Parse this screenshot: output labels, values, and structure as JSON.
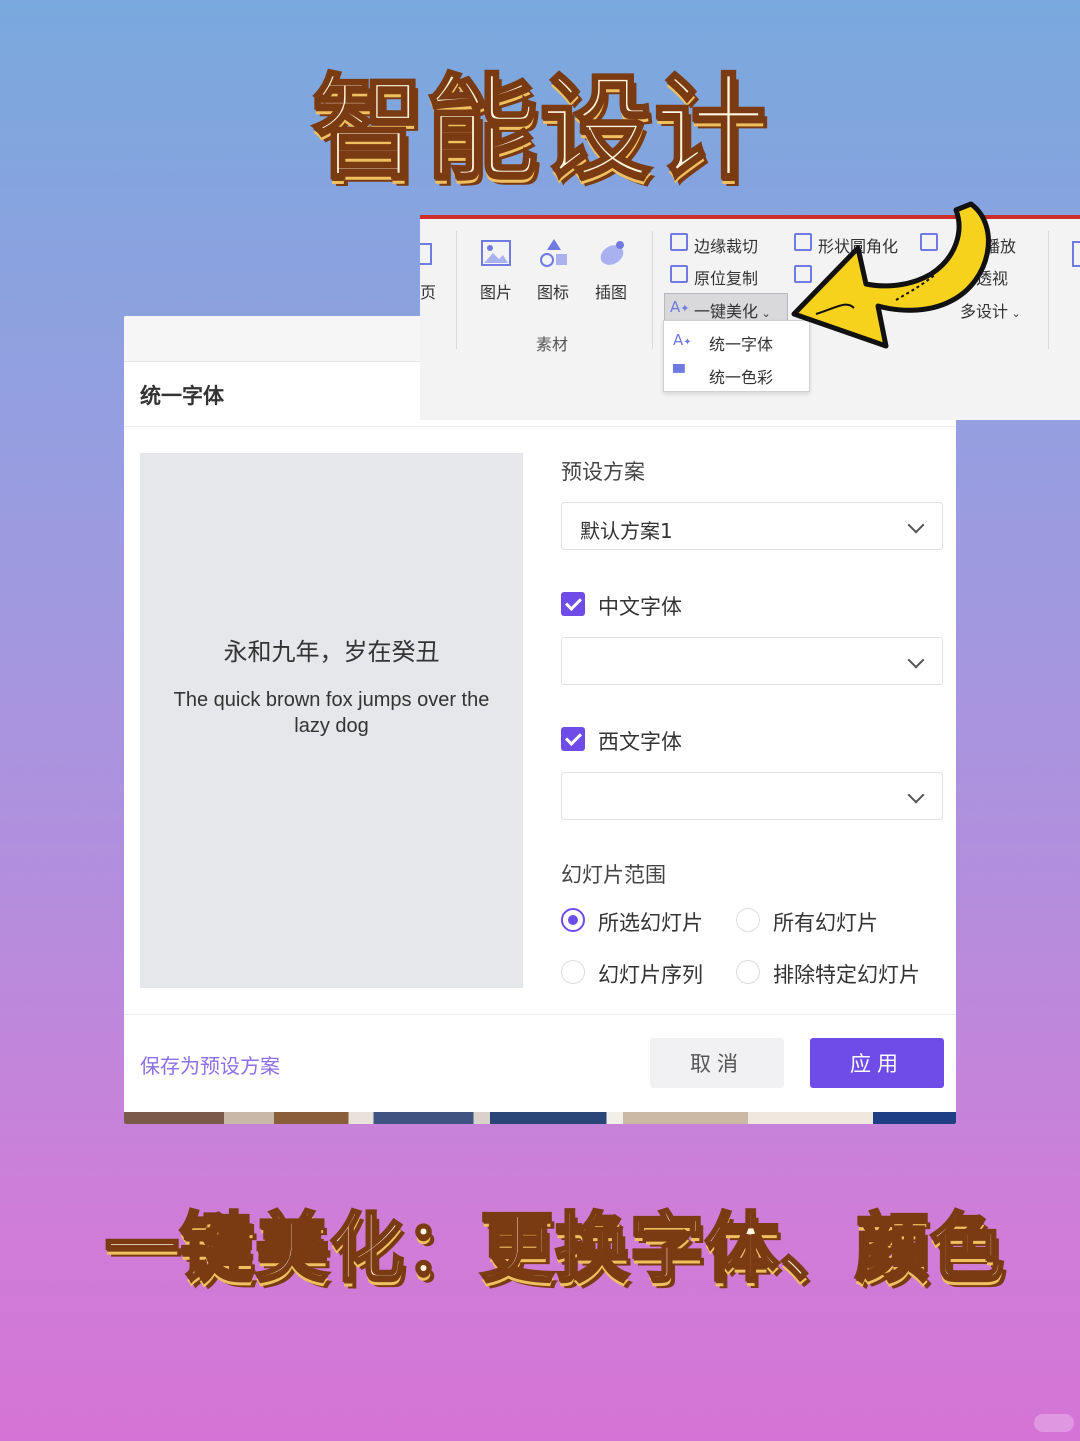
{
  "headline_top": "智能设计",
  "headline_bottom": "一键美化：更换字体、颜色",
  "ribbon": {
    "page_label": "页",
    "tools": [
      {
        "label": "图片",
        "icon": "image-icon"
      },
      {
        "label": "图标",
        "icon": "shapes-icon"
      },
      {
        "label": "插图",
        "icon": "illustration-icon"
      }
    ],
    "group_label": "素材",
    "col1": [
      "边缘裁切",
      "原位复制",
      "一键美化"
    ],
    "col2": [
      "形状圆角化"
    ],
    "col3": [
      "播放",
      "透视",
      "多设计"
    ],
    "dropdown": [
      "统一字体",
      "统一色彩"
    ]
  },
  "dialog": {
    "title": "统一字体",
    "preview_cn": "永和九年，岁在癸丑",
    "preview_en": "The quick brown fox jumps over the lazy dog",
    "preset_label": "预设方案",
    "preset_value": "默认方案1",
    "cn_font_label": "中文字体",
    "cn_font_value": "",
    "en_font_label": "西文字体",
    "en_font_value": "",
    "range_label": "幻灯片范围",
    "range_options": [
      "所选幻灯片",
      "所有幻灯片",
      "幻灯片序列",
      "排除特定幻灯片"
    ],
    "range_selected": "所选幻灯片",
    "save_preset": "保存为预设方案",
    "cancel": "取消",
    "apply": "应用"
  },
  "colors": {
    "accent": "#6f4be8",
    "ribbon_top_border": "#c9302c",
    "headline_fill": "#fff6df",
    "headline_outline": "#7a3a12"
  }
}
